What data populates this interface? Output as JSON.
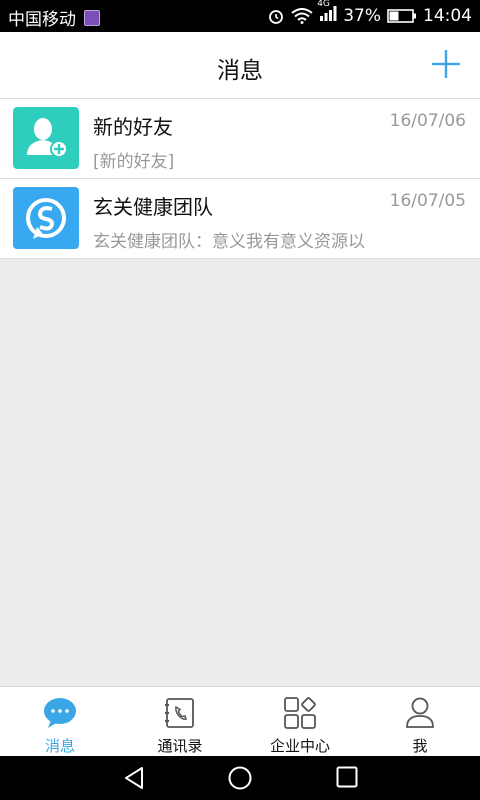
{
  "status": {
    "carrier": "中国移动",
    "network": "4G",
    "battery": "37%",
    "time": "14:04",
    "icons": [
      "gallery-notification-icon",
      "alarm-icon",
      "wifi-icon",
      "signal-icon",
      "battery-icon"
    ]
  },
  "header": {
    "title": "消息"
  },
  "messages": [
    {
      "name": "新的好友",
      "date": "16/07/06",
      "preview": "[新的好友]",
      "avatar": "add-friend-icon",
      "color": "#2fcdbd"
    },
    {
      "name": "玄关健康团队",
      "date": "16/07/05",
      "preview": "玄关健康团队：意义我有意义资源以",
      "avatar": "team-logo-icon",
      "color": "#38a8f0"
    }
  ],
  "tabs": [
    {
      "label": "消息",
      "icon": "chat-bubble-icon",
      "active": true
    },
    {
      "label": "通讯录",
      "icon": "contacts-book-icon",
      "active": false
    },
    {
      "label": "企业中心",
      "icon": "apps-grid-icon",
      "active": false
    },
    {
      "label": "我",
      "icon": "person-icon",
      "active": false
    }
  ],
  "colors": {
    "accent": "#3aa6e6",
    "background": "#ececec"
  }
}
